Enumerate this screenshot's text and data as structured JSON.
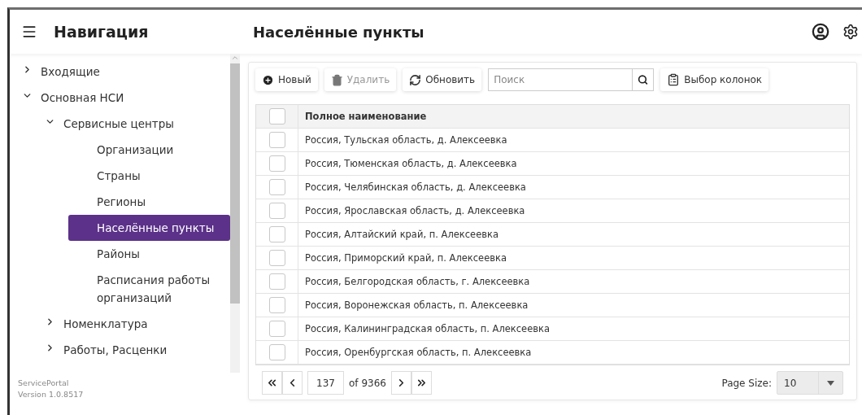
{
  "nav": {
    "title": "Навигация",
    "items": [
      {
        "label": "Входящие",
        "expanded": false,
        "selected": false
      },
      {
        "label": "Основная НСИ",
        "expanded": true,
        "selected": false,
        "children": [
          {
            "label": "Сервисные центры",
            "expanded": true,
            "selected": false,
            "children": [
              {
                "label": "Организации",
                "selected": false
              },
              {
                "label": "Страны",
                "selected": false
              },
              {
                "label": "Регионы",
                "selected": false
              },
              {
                "label": "Населённые пункты",
                "selected": true
              },
              {
                "label": "Районы",
                "selected": false
              },
              {
                "label": "Расписания работы организаций",
                "selected": false
              }
            ]
          },
          {
            "label": "Номенклатура",
            "expanded": false,
            "selected": false
          },
          {
            "label": "Работы, Расценки",
            "expanded": false,
            "selected": false
          }
        ]
      }
    ],
    "footer": [
      "ServicePortal",
      "Version 1.0.8517"
    ]
  },
  "page": {
    "title": "Населённые пункты"
  },
  "toolbar": {
    "buttons": [
      {
        "kind": "new",
        "label": "Новый",
        "disabled": false
      },
      {
        "kind": "delete",
        "label": "Удалить",
        "disabled": true
      },
      {
        "kind": "refresh",
        "label": "Обновить",
        "disabled": false
      }
    ],
    "search": {
      "placeholder": "Поиск"
    },
    "columns_button": "Выбор колонок"
  },
  "table": {
    "header_checked": false,
    "columns": [
      "Полное наименование"
    ],
    "rows": [
      {
        "name": "Россия, Тульская область, д. Алексеевка",
        "checked": false
      },
      {
        "name": "Россия, Тюменская область, д. Алексеевка",
        "checked": false
      },
      {
        "name": "Россия, Челябинская область, д. Алексеевка",
        "checked": false
      },
      {
        "name": "Россия, Ярославская область, д. Алексеевка",
        "checked": false
      },
      {
        "name": "Россия, Алтайский край, п. Алексеевка",
        "checked": false
      },
      {
        "name": "Россия, Приморский край, п. Алексеевка",
        "checked": false
      },
      {
        "name": "Россия, Белгородская область, г. Алексеевка",
        "checked": false
      },
      {
        "name": "Россия, Воронежская область, п. Алексеевка",
        "checked": false
      },
      {
        "name": "Россия, Калининградская область, п. Алексеевка",
        "checked": false
      },
      {
        "name": "Россия, Оренбургская область, п. Алексеевка",
        "checked": false
      }
    ]
  },
  "pager": {
    "page": "137",
    "of": "of 9366",
    "page_size_label": "Page Size:",
    "page_size": "10"
  }
}
